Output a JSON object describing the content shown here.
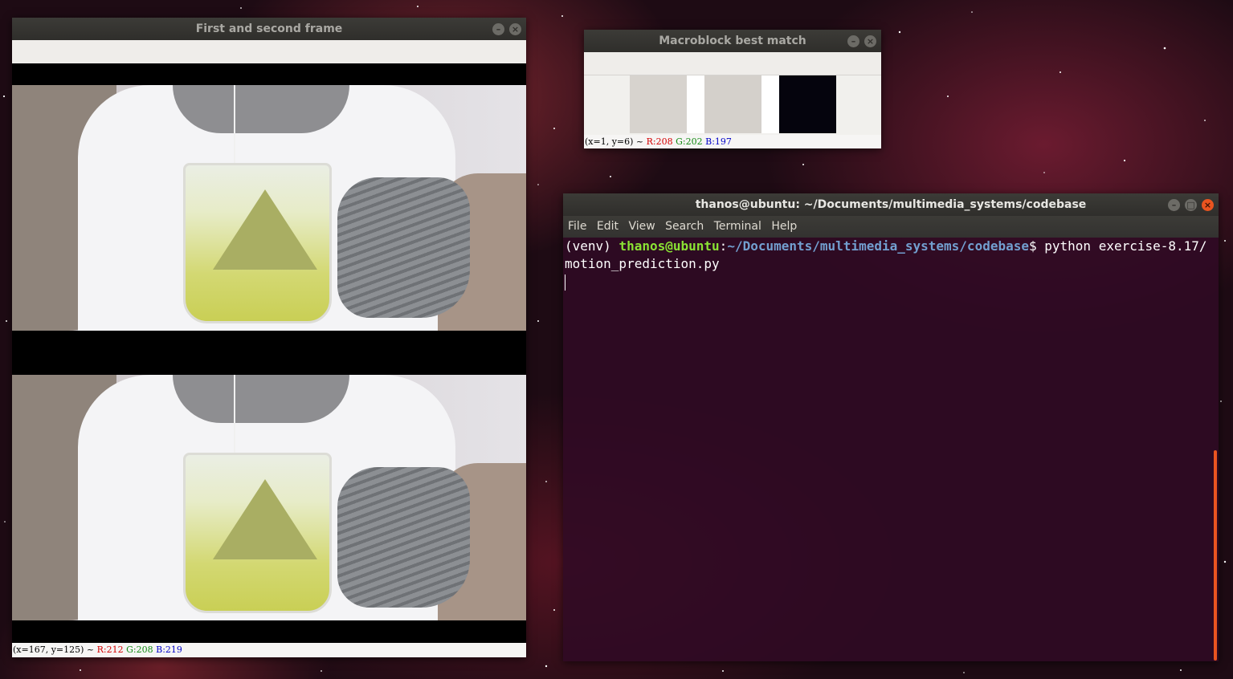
{
  "windows": {
    "frames": {
      "title": "First and second frame",
      "status": {
        "coords": "(x=167, y=125) ~ ",
        "r": "R:212",
        "g": "G:208",
        "b": "B:219"
      }
    },
    "macro": {
      "title": "Macroblock best match",
      "blocks": [
        "#d7d3ce",
        "#d4d0cb",
        "#05040d"
      ],
      "status": {
        "coords": "(x=1, y=6) ~ ",
        "r": "R:208",
        "g": "G:202",
        "b": "B:197"
      }
    },
    "terminal": {
      "title": "thanos@ubuntu: ~/Documents/multimedia_systems/codebase",
      "menu": [
        "File",
        "Edit",
        "View",
        "Search",
        "Terminal",
        "Help"
      ],
      "prompt": {
        "venv": "(venv) ",
        "user": "thanos@ubuntu",
        "colon": ":",
        "path": "~/Documents/multimedia_systems/codebase",
        "dollar": "$ ",
        "command": "python exercise-8.17/motion_prediction.py"
      }
    }
  },
  "colors": {
    "accent": "#e95420",
    "prompt_user": "#8ae234",
    "prompt_path": "#729fcf"
  }
}
